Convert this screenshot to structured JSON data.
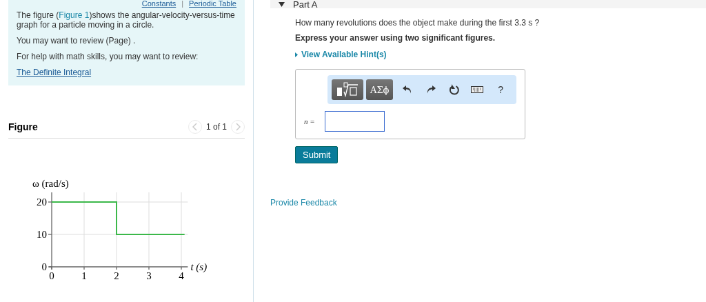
{
  "intro": {
    "links": [
      "Constants",
      "Periodic Table"
    ],
    "separator": "|",
    "paragraphs": [
      {
        "text": "The figure (",
        "link": "Figure 1",
        "after": ")shows the angular-velocity-versus-time graph for a particle moving in a circle."
      },
      {
        "text": "You may want to review (Page) ."
      },
      {
        "text": "For help with math skills, you may want to review:"
      }
    ],
    "review_link": "The Definite Integral"
  },
  "figure": {
    "title": "Figure",
    "pager": "1 of 1",
    "prev_disabled": true,
    "next_disabled": true,
    "chart_data": {
      "type": "line",
      "xlabel": "t (s)",
      "ylabel": "ω (rad/s)",
      "x": [
        0,
        2,
        2,
        4.1
      ],
      "series": [
        {
          "color": "#3cb84a",
          "values": [
            20,
            20,
            10,
            10
          ]
        }
      ],
      "grid": true,
      "xlim": [
        0,
        4.2
      ],
      "ylim": [
        0,
        23
      ],
      "xticks": [
        0,
        1,
        2,
        3,
        4
      ],
      "yticks": [
        0,
        10,
        20
      ]
    }
  },
  "part": {
    "title": "Part A",
    "expanded": true,
    "question": "How many revolutions does the object make during the first 3.3 s ?",
    "instruction": "Express your answer using two significant figures.",
    "hints": "View Available Hint(s)",
    "toolbar": [
      "ΑΣϕ",
      "?"
    ],
    "variable": "n =",
    "submit": "Submit"
  },
  "feedback": "Provide Feedback"
}
